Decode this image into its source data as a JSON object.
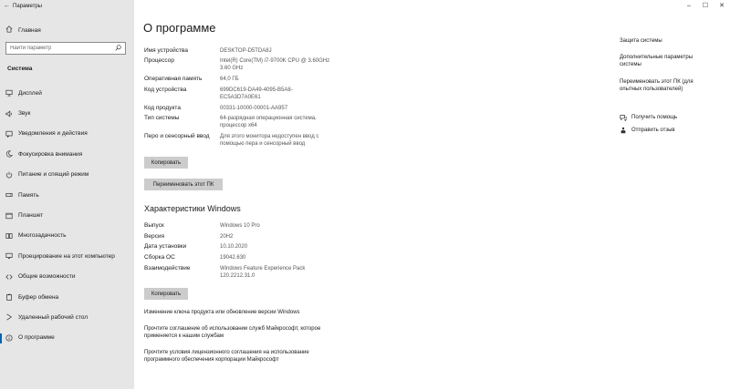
{
  "window": {
    "title": "Параметры"
  },
  "sidebar": {
    "home_label": "Главная",
    "search_placeholder": "Найти параметр",
    "section_title": "Система",
    "items": [
      {
        "label": "Дисплей",
        "icon": "monitor-icon"
      },
      {
        "label": "Звук",
        "icon": "speaker-icon"
      },
      {
        "label": "Уведомления и действия",
        "icon": "notification-icon"
      },
      {
        "label": "Фокусировка внимания",
        "icon": "moon-icon"
      },
      {
        "label": "Питание и спящий режим",
        "icon": "power-icon"
      },
      {
        "label": "Память",
        "icon": "storage-icon"
      },
      {
        "label": "Планшет",
        "icon": "tablet-icon"
      },
      {
        "label": "Многозадачность",
        "icon": "multitask-icon"
      },
      {
        "label": "Проецирование на этот компьютер",
        "icon": "project-icon"
      },
      {
        "label": "Общие возможности",
        "icon": "shared-icon"
      },
      {
        "label": "Буфер обмена",
        "icon": "clipboard-icon"
      },
      {
        "label": "Удаленный рабочий стол",
        "icon": "remote-icon"
      },
      {
        "label": "О программе",
        "icon": "info-icon"
      }
    ]
  },
  "main": {
    "title": "О программе",
    "device_specs": [
      {
        "key": "Имя устройства",
        "value": "DESKTOP-D5TDA8J"
      },
      {
        "key": "Процессор",
        "value": "Intel(R) Core(TM) i7-9700K CPU @ 3.60GHz 3.60 GHz"
      },
      {
        "key": "Оперативная память",
        "value": "64,0 ГБ"
      },
      {
        "key": "Код устройства",
        "value": "699DC619-DA49-4095-B5A8-EC5A3D7A0E61"
      },
      {
        "key": "Код продукта",
        "value": "00331-10000-00001-AA957"
      },
      {
        "key": "Тип системы",
        "value": "64-разрядная операционная система, процессор x64"
      },
      {
        "key": "Перо и сенсорный ввод",
        "value": "Для этого монитора недоступен ввод с помощью пера и сенсорный ввод"
      }
    ],
    "copy_button": "Копировать",
    "rename_button": "Переименовать этот ПК",
    "windows_section_title": "Характеристики Windows",
    "windows_specs": [
      {
        "key": "Выпуск",
        "value": "Windows 10 Pro"
      },
      {
        "key": "Версия",
        "value": "20H2"
      },
      {
        "key": "Дата установки",
        "value": "10.10.2020"
      },
      {
        "key": "Сборка ОС",
        "value": "19042.630"
      },
      {
        "key": "Взаимодействие",
        "value": "Windows Feature Experience Pack 120.2212.31.0"
      }
    ],
    "copy_button2": "Копировать",
    "links": [
      "Изменение ключа продукта или обновление версии Windows",
      "Прочтите соглашение об использовании служб Майкрософт, которое применяется к нашим службам",
      "Прочтите условия лицензионного соглашения на использование программного обеспечения корпорации Майкрософт"
    ]
  },
  "right_panel": {
    "links": [
      "Защита системы",
      "Дополнительные параметры системы",
      "Переименовать этот ПК (для опытных пользователей)"
    ],
    "help": [
      {
        "label": "Получить помощь",
        "icon": "help-chat-icon"
      },
      {
        "label": "Отправить отзыв",
        "icon": "feedback-icon"
      }
    ]
  },
  "window_controls": {
    "minimize": "–",
    "maximize": "☐",
    "close": "✕"
  }
}
